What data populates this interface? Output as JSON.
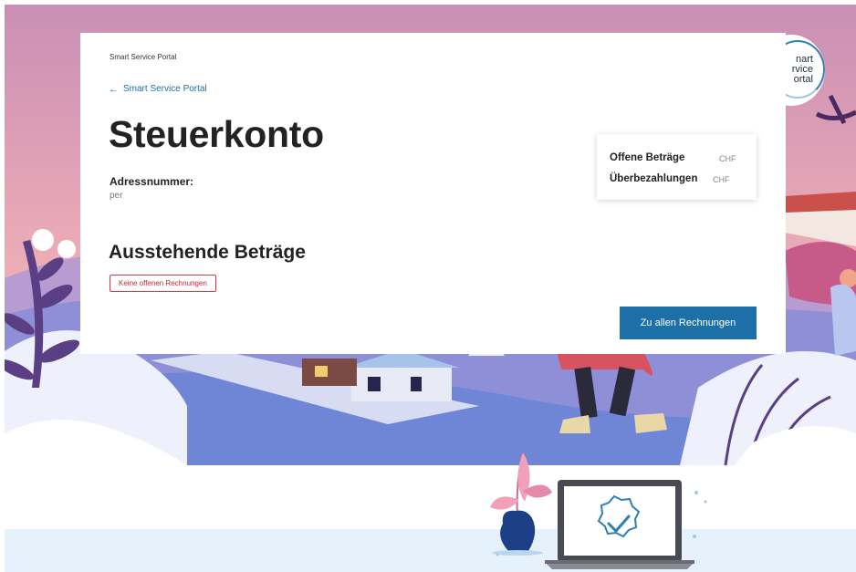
{
  "header": {
    "crumb": "Smart Service Portal",
    "back_link": "Smart Service Portal",
    "logo_text": "nart\nrvice\nortal"
  },
  "account": {
    "title": "Steuerkonto",
    "address_label": "Adressnummer:",
    "address_value": "per"
  },
  "summary": {
    "open_label": "Offene Beträge",
    "open_currency": "CHF",
    "overpaid_label": "Überbezahlungen",
    "overpaid_currency": "CHF"
  },
  "outstanding": {
    "title": "Ausstehende Beträge",
    "badge": "Keine offenen Rechnungen",
    "cta": "Zu allen Rechnungen"
  },
  "colors": {
    "accent": "#1d6fa8",
    "badge_red": "#d23a4b",
    "sky_top": "#c98fb4",
    "sky_bottom": "#f2b8b2",
    "band": "#e5f2fb"
  },
  "icons": [
    "back-arrow-icon",
    "checkmark-badge-icon",
    "laptop-icon",
    "plant-icon"
  ]
}
